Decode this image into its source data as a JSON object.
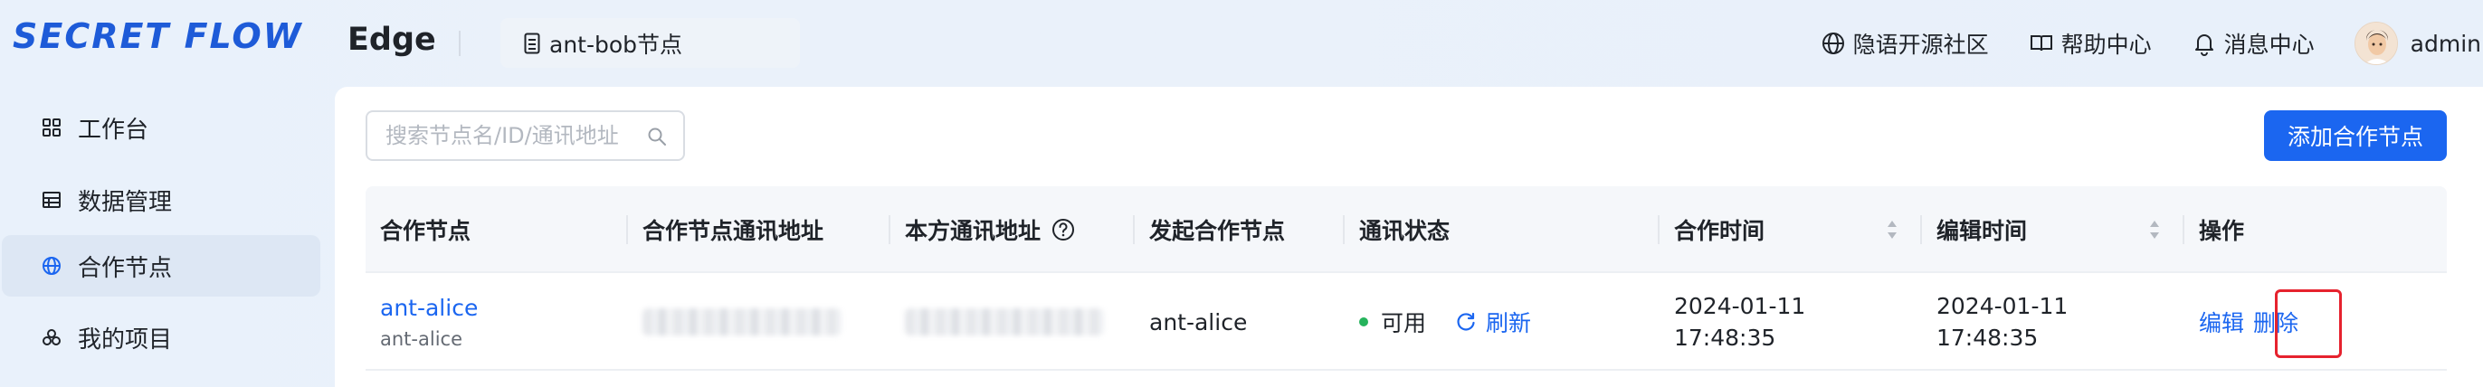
{
  "header": {
    "logo_text": "SECRET FLOW",
    "app_name": "Edge",
    "current_node": "ant-bob节点",
    "links": [
      {
        "icon": "globe-icon",
        "label": "隐语开源社区"
      },
      {
        "icon": "book-icon",
        "label": "帮助中心"
      },
      {
        "icon": "bell-icon",
        "label": "消息中心"
      }
    ],
    "user_name": "admin"
  },
  "sidebar": {
    "items": [
      {
        "icon": "grid-icon",
        "label": "工作台",
        "active": false
      },
      {
        "icon": "table-icon",
        "label": "数据管理",
        "active": false
      },
      {
        "icon": "globe-icon",
        "label": "合作节点",
        "active": true
      },
      {
        "icon": "project-icon",
        "label": "我的项目",
        "active": false
      }
    ]
  },
  "toolbar": {
    "search_placeholder": "搜索节点名/ID/通讯地址",
    "add_button": "添加合作节点"
  },
  "table": {
    "columns": [
      "合作节点",
      "合作节点通讯地址",
      "本方通讯地址",
      "发起合作节点",
      "通讯状态",
      "合作时间",
      "编辑时间",
      "操作"
    ],
    "rows": [
      {
        "node_name": "ant-alice",
        "node_id": "ant-alice",
        "initiator": "ant-alice",
        "status": "可用",
        "refresh_label": "刷新",
        "coop_date": "2024-01-11",
        "coop_time": "17:48:35",
        "edit_date": "2024-01-11",
        "edit_time": "17:48:35",
        "edit_label": "编辑",
        "delete_label": "删除"
      }
    ]
  },
  "colors": {
    "accent": "#1b66f0",
    "status_ok": "#25b35c",
    "highlight": "#e6222e"
  }
}
